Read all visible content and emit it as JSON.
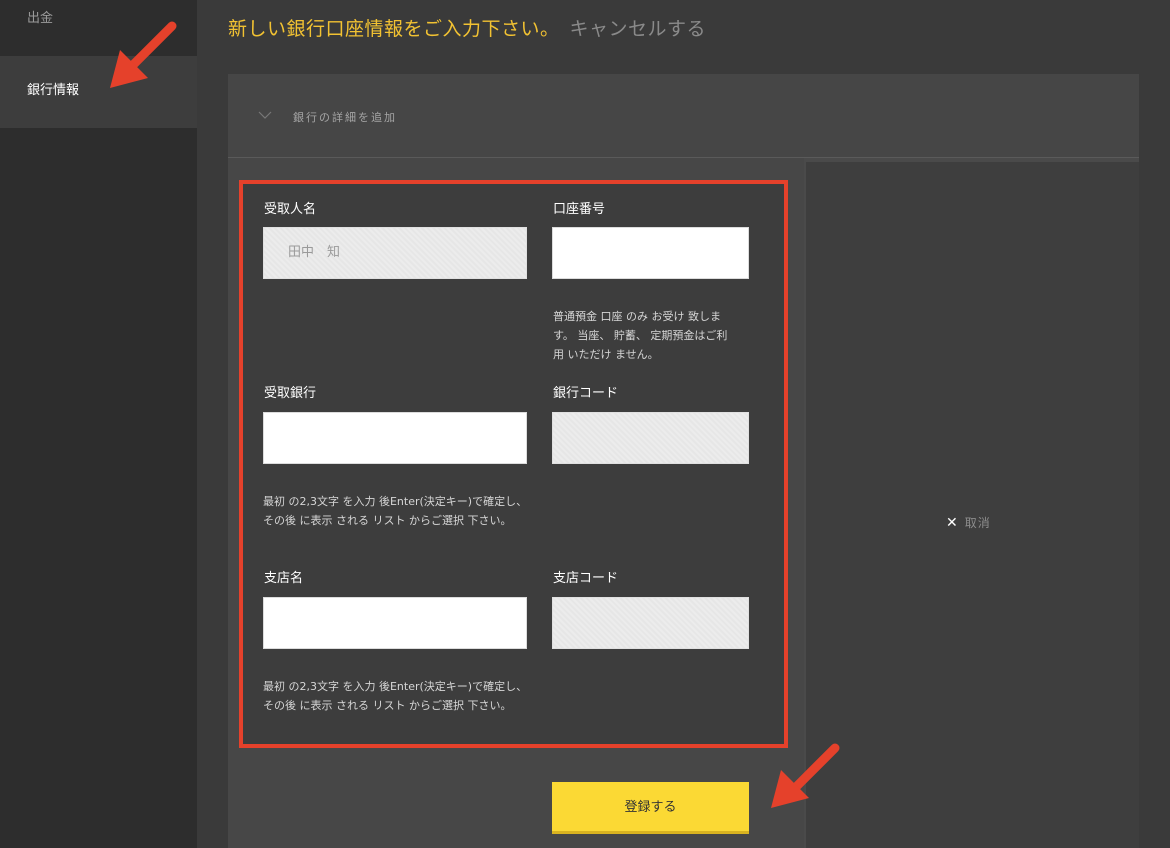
{
  "sidebar": {
    "items": [
      {
        "label": "出金"
      },
      {
        "label": "銀行情報"
      }
    ]
  },
  "header": {
    "title": "新しい銀行口座情報をご入力下さい。",
    "cancel": "キャンセルする"
  },
  "accordion": {
    "label": "銀行の詳細を追加"
  },
  "form": {
    "recipient_name": {
      "label": "受取人名",
      "value": "田中　知"
    },
    "account_number": {
      "label": "口座番号",
      "value": "",
      "hint": "普通預金 口座 のみ お受け 致します。 当座、 貯蓄、 定期預金はご利用 いただけ ません。"
    },
    "bank_name": {
      "label": "受取銀行",
      "value": "",
      "hint": "最初 の2,3文字 を入力 後Enter(決定キー)で確定し、 その後 に表示 される リスト からご選択 下さい。"
    },
    "bank_code": {
      "label": "銀行コード",
      "value": ""
    },
    "branch_name": {
      "label": "支店名",
      "value": "",
      "hint": "最初 の2,3文字 を入力 後Enter(決定キー)で確定し、 その後 に表示 される リスト からご選択 下さい。"
    },
    "branch_code": {
      "label": "支店コード",
      "value": ""
    }
  },
  "actions": {
    "submit": "登録する",
    "cancel": "取消"
  },
  "colors": {
    "accent": "#f2c232",
    "button": "#fbd934",
    "annotation": "#e5412b"
  }
}
